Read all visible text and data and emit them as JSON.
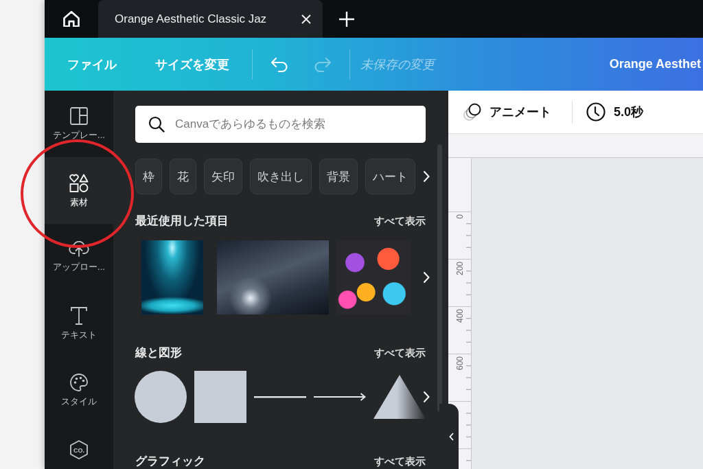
{
  "tab_bar": {
    "tabs": [
      {
        "title": "Orange Aesthetic Classic Jaz",
        "selected": true
      }
    ]
  },
  "toolbar": {
    "menus": [
      "ファイル",
      "サイズを変更"
    ],
    "history": [
      {
        "kind": "undo",
        "disabled": false
      },
      {
        "kind": "redo",
        "disabled": true
      }
    ],
    "save_status": "未保存の変更",
    "design_title": "Orange Aesthet"
  },
  "sidebar": {
    "items": [
      {
        "kind": "template",
        "label": "テンプレー...",
        "selected": false,
        "annotated": false
      },
      {
        "kind": "elements",
        "label": "素材",
        "selected": true,
        "annotated": true
      },
      {
        "kind": "upload",
        "label": "アップロー...",
        "selected": false,
        "annotated": false
      },
      {
        "kind": "text",
        "label": "テキスト",
        "selected": false,
        "annotated": false
      },
      {
        "kind": "palette",
        "label": "スタイル",
        "selected": false,
        "annotated": false
      },
      {
        "kind": "logo",
        "icon_text": "CO.",
        "selected": false,
        "annotated": false
      }
    ]
  },
  "panel": {
    "search": {
      "placeholder": "Canvaであらゆるものを検索"
    },
    "chips": [
      "枠",
      "花",
      "矢印",
      "吹き出し",
      "背景",
      "ハート"
    ],
    "sections": [
      {
        "kind": "media",
        "title": "最近使用した項目",
        "link": "すべて表示",
        "items": [
          {
            "kind": "photo"
          },
          {
            "kind": "photo"
          },
          {
            "kind": "illustration"
          }
        ]
      },
      {
        "kind": "shapes",
        "title": "線と図形",
        "link": "すべて表示",
        "items": [
          {
            "kind": "circle"
          },
          {
            "kind": "square"
          },
          {
            "kind": "line"
          },
          {
            "kind": "arrow"
          },
          {
            "kind": "triangle"
          }
        ]
      },
      {
        "kind": "media",
        "title": "グラフィック",
        "link": "すべて表示"
      }
    ]
  },
  "workspace": {
    "animate": "アニメート",
    "duration": "5.0秒",
    "ruler_labels": [
      "0",
      "200",
      "400",
      "600"
    ]
  }
}
